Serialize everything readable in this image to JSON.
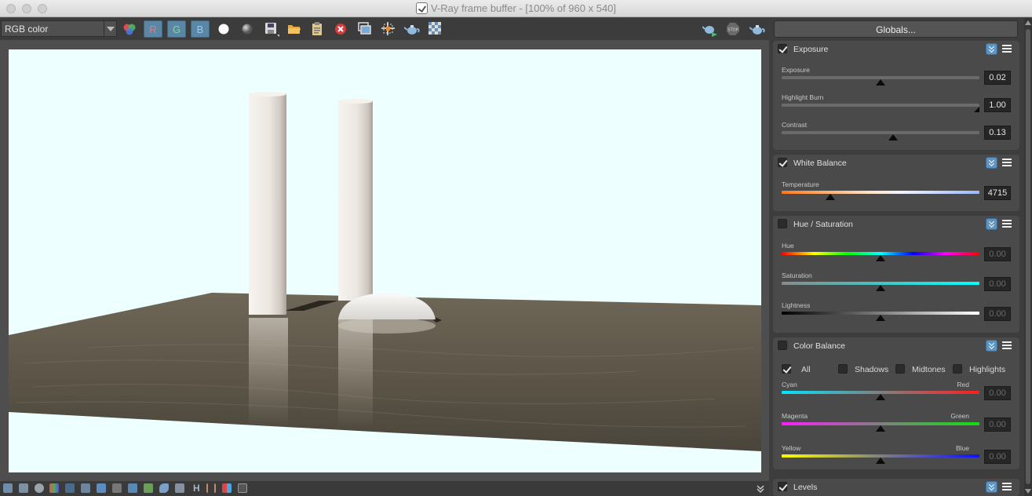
{
  "window": {
    "title": "V-Ray frame buffer - [100% of 960 x 540]"
  },
  "toolbar": {
    "channel": "RGB color",
    "r_label": "R",
    "g_label": "G",
    "b_label": "B",
    "icons": [
      "color-correction-icon",
      "white-dot-icon",
      "gray-dot-icon",
      "save-icon",
      "open-folder-icon",
      "clipboard-icon",
      "clear-icon",
      "duplicate-icon",
      "region-icon",
      "render-teapot-icon",
      "checker-icon",
      "render-interactive-icon",
      "stop-icon",
      "render-icon"
    ]
  },
  "panel": {
    "globals_label": "Globals...",
    "exposure": {
      "title": "Exposure",
      "enabled": true,
      "sliders": [
        {
          "label": "Exposure",
          "value": "0.02",
          "position": 0.5
        },
        {
          "label": "Highlight Burn",
          "value": "1.00",
          "position": 1.0
        },
        {
          "label": "Contrast",
          "value": "0.13",
          "position": 0.565
        }
      ]
    },
    "white_balance": {
      "title": "White Balance",
      "enabled": true,
      "slider": {
        "label": "Temperature",
        "value": "4715",
        "position": 0.245
      }
    },
    "hue_saturation": {
      "title": "Hue / Saturation",
      "enabled": false,
      "sliders": [
        {
          "label": "Hue",
          "value": "0.00",
          "position": 0.5
        },
        {
          "label": "Saturation",
          "value": "0.00",
          "position": 0.5
        },
        {
          "label": "Lightness",
          "value": "0.00",
          "position": 0.5
        }
      ]
    },
    "color_balance": {
      "title": "Color Balance",
      "enabled": false,
      "options": [
        {
          "label": "All",
          "checked": true
        },
        {
          "label": "Shadows",
          "checked": false
        },
        {
          "label": "Midtones",
          "checked": false
        },
        {
          "label": "Highlights",
          "checked": false
        }
      ],
      "sliders": [
        {
          "left": "Cyan",
          "right": "Red",
          "value": "0.00",
          "position": 0.5
        },
        {
          "left": "Magenta",
          "right": "Green",
          "value": "0.00",
          "position": 0.5
        },
        {
          "left": "Yellow",
          "right": "Blue",
          "value": "0.00",
          "position": 0.5
        }
      ]
    },
    "levels": {
      "title": "Levels",
      "enabled": true
    }
  },
  "bottombar": {
    "h_label": "H"
  }
}
